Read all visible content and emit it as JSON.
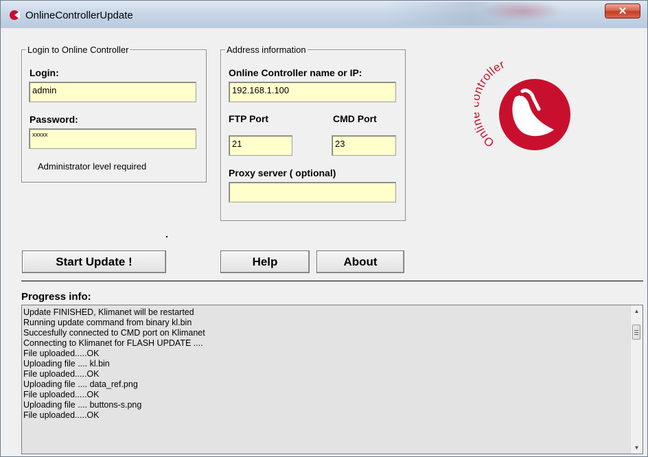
{
  "window": {
    "title": "OnlineControllerUpdate"
  },
  "login_group": {
    "legend": "Login to Online Controller",
    "login_label": "Login:",
    "login_value": "admin",
    "password_label": "Password:",
    "password_value": "xxxxx",
    "note": "Administrator level required"
  },
  "address_group": {
    "legend": "Address information",
    "name_label": "Online Controller name or IP:",
    "name_value": "192.168.1.100",
    "ftp_label": "FTP Port",
    "ftp_value": "21",
    "cmd_label": "CMD Port",
    "cmd_value": "23",
    "proxy_label": "Proxy server ( optional)",
    "proxy_value": ""
  },
  "logo": {
    "text": "Online controller"
  },
  "buttons": {
    "start": "Start Update !",
    "help": "Help",
    "about": "About"
  },
  "progress": {
    "label": "Progress info:",
    "lines": [
      "Update FINISHED, Klimanet will be restarted",
      "Running update command from binary kl.bin",
      "Succesfully connected to CMD port on Klimanet",
      "Connecting to Klimanet for FLASH UPDATE ....",
      "File uploaded.....OK",
      "Uploading file .... kl.bin",
      "File uploaded.....OK",
      "Uploading file .... data_ref.png",
      "File uploaded.....OK",
      "Uploading file .... buttons-s.png",
      "File uploaded.....OK"
    ]
  },
  "colors": {
    "field_bg": "#ffffcc",
    "logo_red": "#c8102e",
    "close_red": "#c43d24"
  }
}
